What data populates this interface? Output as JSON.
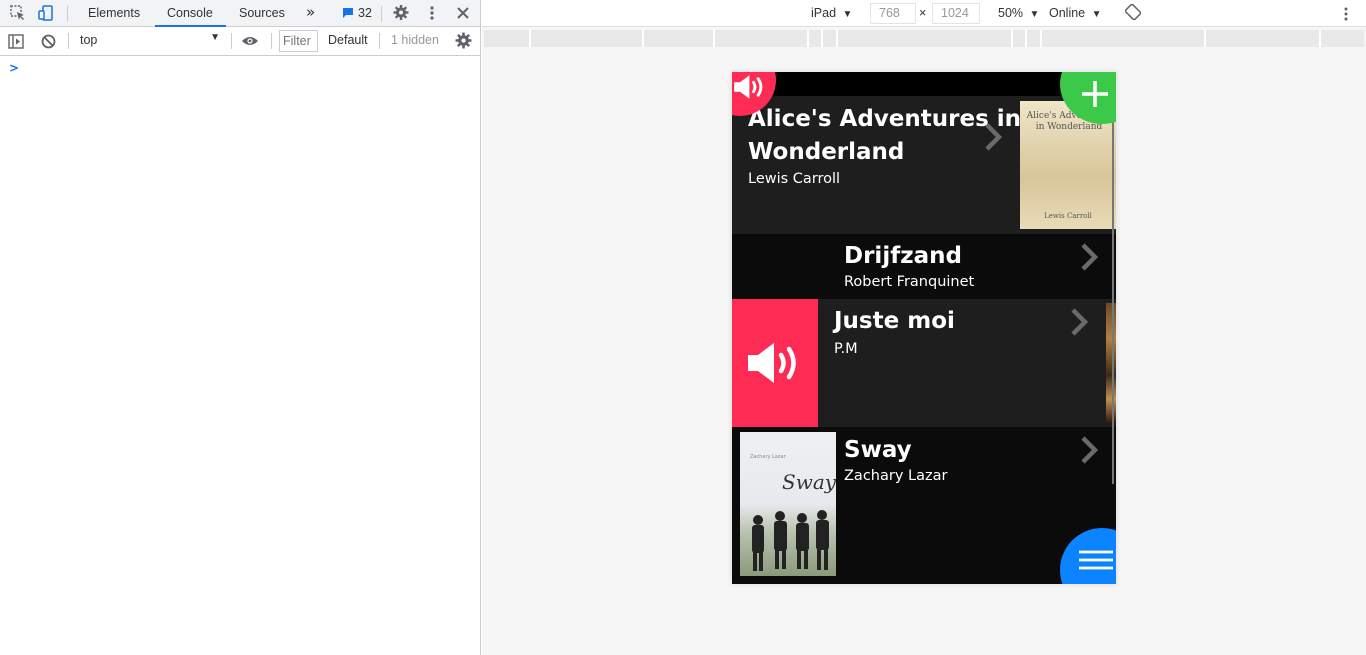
{
  "devtools": {
    "tabs": [
      "Elements",
      "Console",
      "Sources"
    ],
    "active_tab": "Console",
    "more_tabs_glyph": "»",
    "message_count": "32",
    "context": "top",
    "filter_placeholder": "Filter",
    "levels": "Default",
    "hidden": "1 hidden",
    "prompt": ">"
  },
  "emulation": {
    "device": "iPad",
    "width": "768",
    "times": "×",
    "height": "1024",
    "zoom": "50%",
    "network": "Online"
  },
  "app": {
    "books": [
      {
        "title_line1": "Alice's Adventures in",
        "title_line2": "Wonderland",
        "author": "Lewis Carroll",
        "cover_title": "Alice's Adventures in Wonderland",
        "cover_author": "Lewis Carroll"
      },
      {
        "title": "Drijfzand",
        "author": "Robert Franquinet"
      },
      {
        "title": "Juste moi",
        "author": "P.M"
      },
      {
        "title": "Sway",
        "author": "Zachary Lazar",
        "cover_title": "Sway",
        "cover_author": "Zachary Lazar"
      }
    ]
  },
  "colors": {
    "accent_red": "#fe2c54",
    "accent_green": "#3cc94a",
    "accent_blue": "#0d84ff",
    "devtools_blue": "#1a73e8"
  }
}
